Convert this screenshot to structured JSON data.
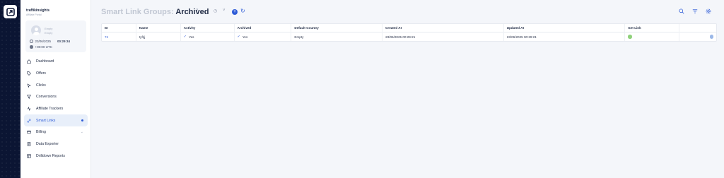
{
  "brand": {
    "name": "traffikinsights",
    "subtitle": "Affiliate Portal"
  },
  "user": {
    "line1": "Empty",
    "line2": "Empty",
    "date": "23/06/2025",
    "time": "00:29:34",
    "timezone": "+00:00 UTC"
  },
  "nav": [
    {
      "label": "Dashboard",
      "icon": "home-icon"
    },
    {
      "label": "Offers",
      "icon": "tag-icon"
    },
    {
      "label": "Clicks",
      "icon": "click-icon"
    },
    {
      "label": "Conversions",
      "icon": "funnel-icon"
    },
    {
      "label": "Affiliate Trackers",
      "icon": "tracker-icon"
    },
    {
      "label": "Smart Links",
      "icon": "link-icon",
      "active": true
    },
    {
      "label": "Billing",
      "icon": "billing-icon"
    },
    {
      "label": "Data Exporter",
      "icon": "export-icon"
    },
    {
      "label": "Drilldown Reports",
      "icon": "report-icon"
    }
  ],
  "header": {
    "title_prefix": "Smart Link Groups:",
    "title_filter": "Archived",
    "chevron": "˅",
    "dot": "·",
    "clock": "◷",
    "plus": "+",
    "refresh": "↻"
  },
  "table": {
    "columns": [
      "ID",
      "Name",
      "Activity",
      "Archived",
      "Default Country",
      "Created At",
      "Updated At",
      "Get Link",
      ""
    ],
    "rows": [
      {
        "id": "74",
        "name": "tyfrjj",
        "activity": "Yes",
        "archived": "Yes",
        "default_country": "Empty",
        "created_at": "23/06/2025 00:29:21",
        "updated_at": "23/06/2025 00:29:21"
      }
    ]
  },
  "colors": {
    "accent": "#2d5bd7",
    "rail": "#0b1533",
    "active_bg": "#e8effa",
    "success": "#8fd17b"
  }
}
